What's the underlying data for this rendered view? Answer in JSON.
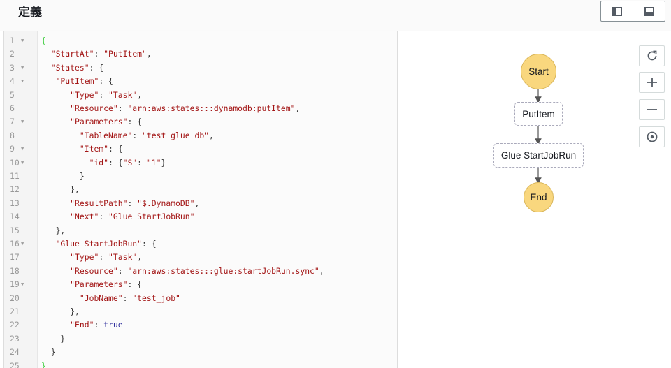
{
  "header": {
    "title": "定義",
    "view_buttons": [
      "split-vertical",
      "split-horizontal"
    ]
  },
  "editor": {
    "lines": [
      {
        "n": "1",
        "fold": true,
        "t": [
          [
            "g",
            "{"
          ]
        ]
      },
      {
        "n": "2",
        "fold": false,
        "t": [
          [
            "p",
            "  "
          ],
          [
            "k",
            "\"StartAt\""
          ],
          [
            "p",
            ": "
          ],
          [
            "k",
            "\"PutItem\""
          ],
          [
            "p",
            ","
          ]
        ]
      },
      {
        "n": "3",
        "fold": true,
        "t": [
          [
            "p",
            "  "
          ],
          [
            "k",
            "\"States\""
          ],
          [
            "p",
            ": {"
          ]
        ]
      },
      {
        "n": "4",
        "fold": true,
        "t": [
          [
            "p",
            "   "
          ],
          [
            "k",
            "\"PutItem\""
          ],
          [
            "p",
            ": {"
          ]
        ]
      },
      {
        "n": "5",
        "fold": false,
        "t": [
          [
            "p",
            "      "
          ],
          [
            "k",
            "\"Type\""
          ],
          [
            "p",
            ": "
          ],
          [
            "k",
            "\"Task\""
          ],
          [
            "p",
            ","
          ]
        ]
      },
      {
        "n": "6",
        "fold": false,
        "t": [
          [
            "p",
            "      "
          ],
          [
            "k",
            "\"Resource\""
          ],
          [
            "p",
            ": "
          ],
          [
            "k",
            "\"arn:aws:states:::dynamodb:putItem\""
          ],
          [
            "p",
            ","
          ]
        ]
      },
      {
        "n": "7",
        "fold": true,
        "t": [
          [
            "p",
            "      "
          ],
          [
            "k",
            "\"Parameters\""
          ],
          [
            "p",
            ": {"
          ]
        ]
      },
      {
        "n": "8",
        "fold": false,
        "t": [
          [
            "p",
            "        "
          ],
          [
            "k",
            "\"TableName\""
          ],
          [
            "p",
            ": "
          ],
          [
            "k",
            "\"test_glue_db\""
          ],
          [
            "p",
            ","
          ]
        ]
      },
      {
        "n": "9",
        "fold": true,
        "t": [
          [
            "p",
            "        "
          ],
          [
            "k",
            "\"Item\""
          ],
          [
            "p",
            ": {"
          ]
        ]
      },
      {
        "n": "10",
        "fold": true,
        "t": [
          [
            "p",
            "          "
          ],
          [
            "k",
            "\"id\""
          ],
          [
            "p",
            ": {"
          ],
          [
            "k",
            "\"S\""
          ],
          [
            "p",
            ": "
          ],
          [
            "k",
            "\"1\""
          ],
          [
            "p",
            "}"
          ]
        ]
      },
      {
        "n": "11",
        "fold": false,
        "t": [
          [
            "p",
            "        }"
          ]
        ]
      },
      {
        "n": "12",
        "fold": false,
        "t": [
          [
            "p",
            "      },"
          ]
        ]
      },
      {
        "n": "13",
        "fold": false,
        "t": [
          [
            "p",
            "      "
          ],
          [
            "k",
            "\"ResultPath\""
          ],
          [
            "p",
            ": "
          ],
          [
            "k",
            "\"$.DynamoDB\""
          ],
          [
            "p",
            ","
          ]
        ]
      },
      {
        "n": "14",
        "fold": false,
        "t": [
          [
            "p",
            "      "
          ],
          [
            "k",
            "\"Next\""
          ],
          [
            "p",
            ": "
          ],
          [
            "k",
            "\"Glue StartJobRun\""
          ]
        ]
      },
      {
        "n": "15",
        "fold": false,
        "t": [
          [
            "p",
            "   },"
          ]
        ]
      },
      {
        "n": "16",
        "fold": true,
        "t": [
          [
            "p",
            "   "
          ],
          [
            "k",
            "\"Glue StartJobRun\""
          ],
          [
            "p",
            ": {"
          ]
        ]
      },
      {
        "n": "17",
        "fold": false,
        "t": [
          [
            "p",
            "      "
          ],
          [
            "k",
            "\"Type\""
          ],
          [
            "p",
            ": "
          ],
          [
            "k",
            "\"Task\""
          ],
          [
            "p",
            ","
          ]
        ]
      },
      {
        "n": "18",
        "fold": false,
        "t": [
          [
            "p",
            "      "
          ],
          [
            "k",
            "\"Resource\""
          ],
          [
            "p",
            ": "
          ],
          [
            "k",
            "\"arn:aws:states:::glue:startJobRun.sync\""
          ],
          [
            "p",
            ","
          ]
        ]
      },
      {
        "n": "19",
        "fold": true,
        "t": [
          [
            "p",
            "      "
          ],
          [
            "k",
            "\"Parameters\""
          ],
          [
            "p",
            ": {"
          ]
        ]
      },
      {
        "n": "20",
        "fold": false,
        "t": [
          [
            "p",
            "        "
          ],
          [
            "k",
            "\"JobName\""
          ],
          [
            "p",
            ": "
          ],
          [
            "k",
            "\"test_job\""
          ]
        ]
      },
      {
        "n": "21",
        "fold": false,
        "t": [
          [
            "p",
            "      },"
          ]
        ]
      },
      {
        "n": "22",
        "fold": false,
        "t": [
          [
            "p",
            "      "
          ],
          [
            "k",
            "\"End\""
          ],
          [
            "p",
            ": "
          ],
          [
            "b",
            "true"
          ]
        ]
      },
      {
        "n": "23",
        "fold": false,
        "t": [
          [
            "p",
            "    }"
          ]
        ]
      },
      {
        "n": "24",
        "fold": false,
        "t": [
          [
            "p",
            "  }"
          ]
        ]
      },
      {
        "n": "25",
        "fold": false,
        "t": [
          [
            "g",
            "}"
          ]
        ]
      }
    ]
  },
  "graph": {
    "controls": [
      "refresh",
      "zoom-in",
      "zoom-out",
      "center"
    ],
    "nodes": {
      "start": "Start",
      "putitem": "PutItem",
      "glue": "Glue StartJobRun",
      "end": "End"
    }
  },
  "colors": {
    "node_fill": "#f9d77e",
    "string": "#a31515",
    "boolean": "#2d2d9c"
  }
}
